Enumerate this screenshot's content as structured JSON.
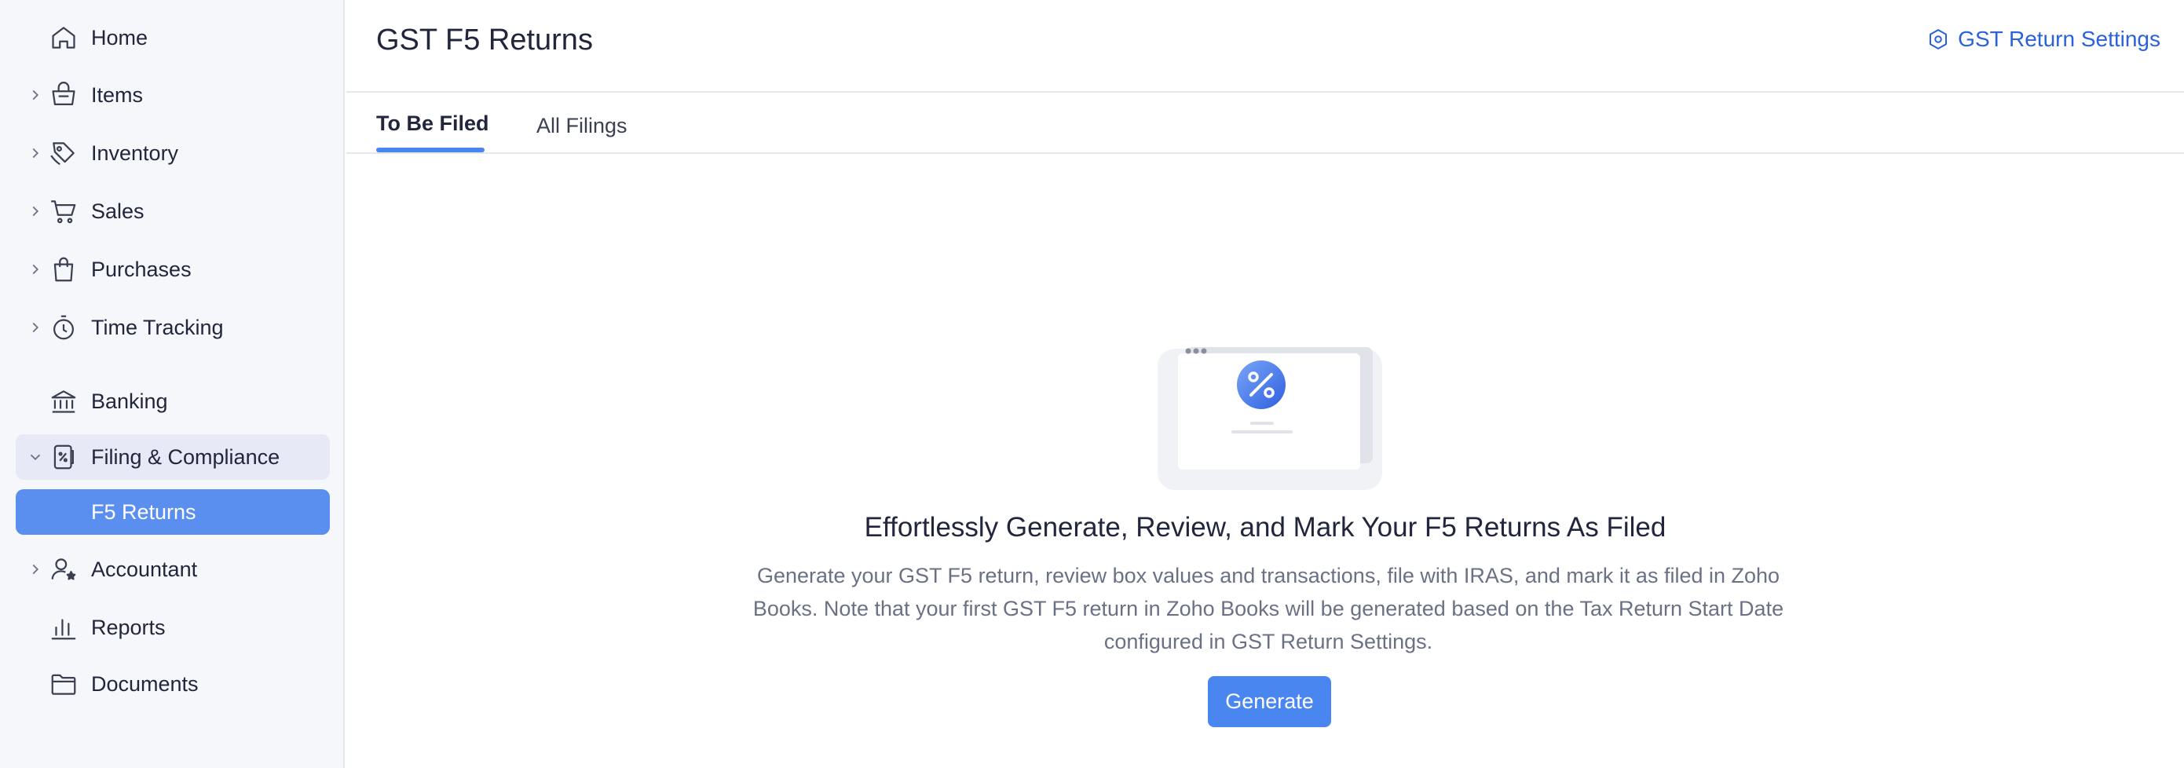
{
  "sidebar": {
    "items": [
      {
        "label": "Home",
        "icon": "home-icon"
      },
      {
        "label": "Items",
        "icon": "basket-icon"
      },
      {
        "label": "Inventory",
        "icon": "tag-icon"
      },
      {
        "label": "Sales",
        "icon": "cart-icon"
      },
      {
        "label": "Purchases",
        "icon": "bag-icon"
      },
      {
        "label": "Time Tracking",
        "icon": "stopwatch-icon"
      },
      {
        "label": "Banking",
        "icon": "bank-icon"
      },
      {
        "label": "Filing & Compliance",
        "icon": "filing-icon"
      },
      {
        "label": "F5 Returns",
        "icon": ""
      },
      {
        "label": "Accountant",
        "icon": "accountant-icon"
      },
      {
        "label": "Reports",
        "icon": "bar-chart-icon"
      },
      {
        "label": "Documents",
        "icon": "folder-icon"
      }
    ]
  },
  "header": {
    "title": "GST F5 Returns",
    "settings_label": "GST Return Settings"
  },
  "tabs": [
    {
      "label": "To Be Filed"
    },
    {
      "label": "All Filings"
    }
  ],
  "empty_state": {
    "title": "Effortlessly Generate, Review, and Mark Your F5 Returns As Filed",
    "description": "Generate your GST F5 return, review box values and transactions, file with IRAS, and mark it as filed in Zoho Books. Note that your first GST F5 return in Zoho Books will be generated based on the Tax Return Start Date configured in GST Return Settings.",
    "button_label": "Generate"
  },
  "colors": {
    "accent": "#4a86f0",
    "link": "#2a62d9",
    "sidebar_bg": "#f6f7fb"
  }
}
